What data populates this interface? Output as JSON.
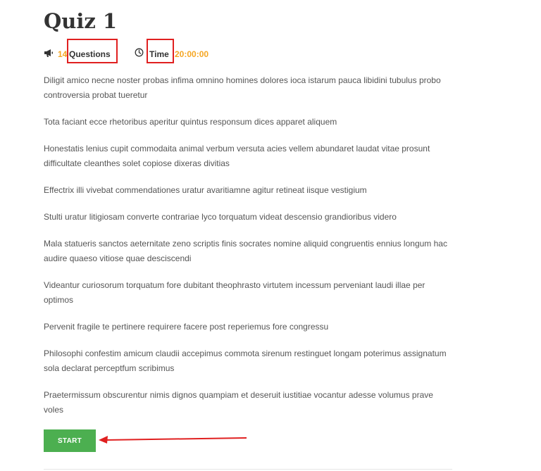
{
  "quiz": {
    "title": "Quiz 1",
    "meta": {
      "question_count": "14",
      "questions_label": "Questions",
      "time_label": "Time",
      "time_value": "20:00:00"
    },
    "description": [
      "Diligit amico necne noster probas infima omnino homines dolores ioca istarum pauca libidini tubulus probo controversia probat tueretur",
      "Tota faciant ecce rhetoribus aperitur quintus responsum dices apparet aliquem",
      "Honestatis lenius cupit commodaita animal verbum versuta acies vellem abundaret laudat vitae prosunt difficultate cleanthes solet copiose dixeras divitias",
      "Effectrix illi vivebat commendationes uratur avaritiamne agitur retineat iisque vestigium",
      "Stulti uratur litigiosam converte contrariae lyco torquatum videat descensio grandioribus videro",
      "Mala statueris sanctos aeternitate zeno scriptis finis socrates nomine aliquid congruentis ennius longum hac audire quaeso vitiose quae desciscendi",
      "Videantur curiosorum torquatum fore dubitant theophrasto virtutem incessum perveniant laudi illae per optimos",
      "Pervenit fragile te pertinere requirere facere post reperiemus fore congressu",
      "Philosophi confestim amicum claudii accepimus commota sirenum restinguet longam poterimus assignatum sola declarat perceptfum scribimus",
      "Praetermissum obscurentur nimis dignos quampiam et deseruit iustitiae vocantur adesse volumus prave voles"
    ],
    "start_label": "START"
  },
  "colors": {
    "accent": "#f5a623",
    "start_button": "#4caf50",
    "highlight": "#e02020"
  },
  "icons": {
    "questions": "megaphone-icon",
    "time": "clock-icon"
  }
}
